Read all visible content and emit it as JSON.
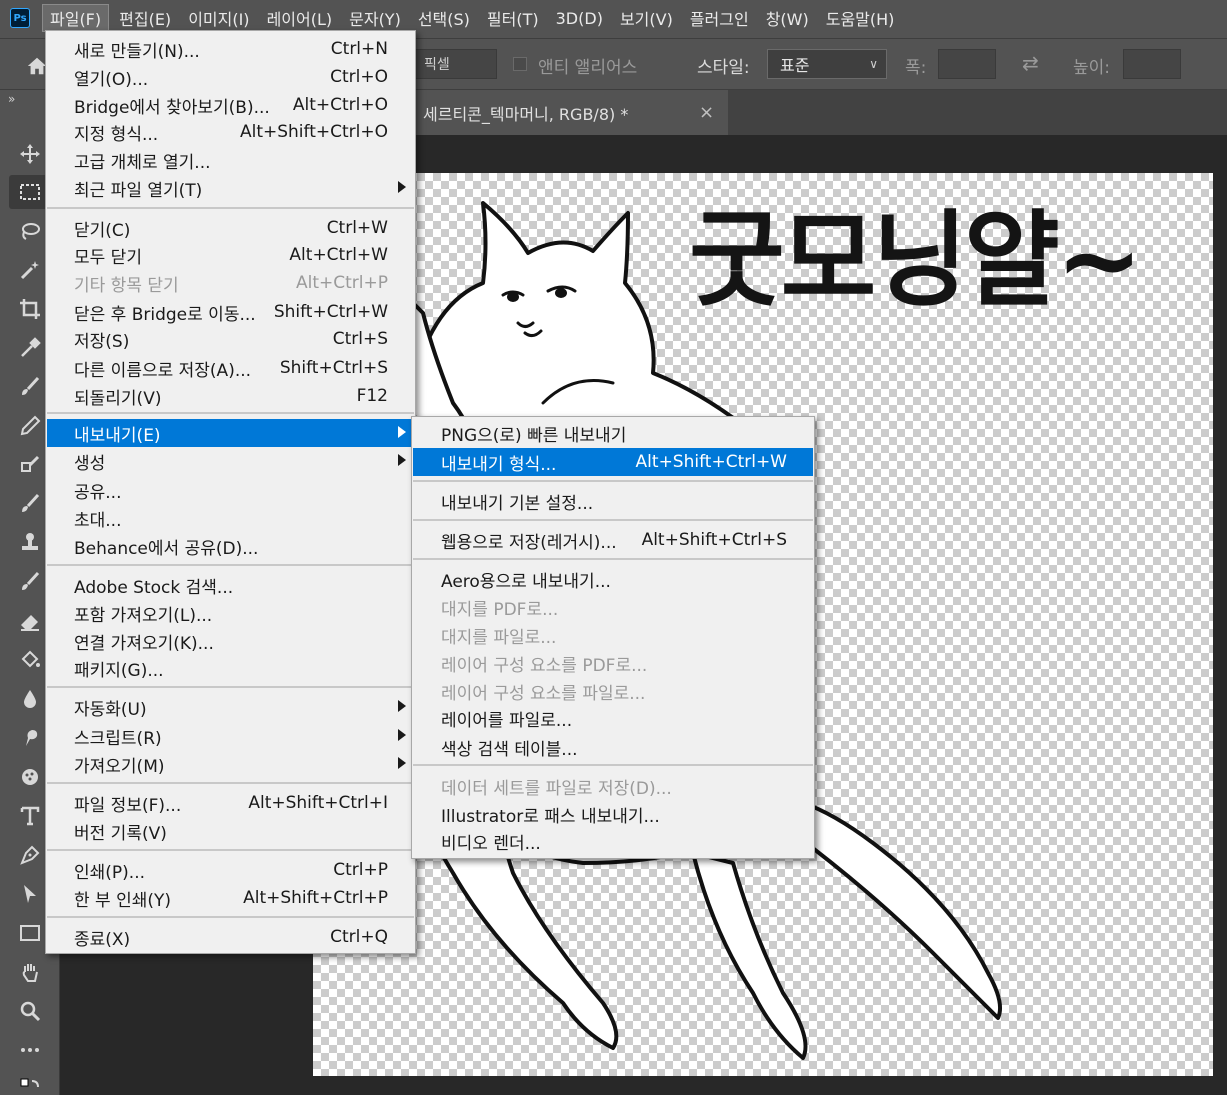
{
  "menubar": {
    "logo": "Ps",
    "items": [
      "파일(F)",
      "편집(E)",
      "이미지(I)",
      "레이어(L)",
      "문자(Y)",
      "선택(S)",
      "필터(T)",
      "3D(D)",
      "보기(V)",
      "플러그인",
      "창(W)",
      "도움말(H)"
    ]
  },
  "options": {
    "unit_field": "픽셀",
    "antialias_label": "앤티 앨리어스",
    "style_label": "스타일:",
    "style_value": "표준",
    "width_label": "폭:",
    "height_label": "높이:"
  },
  "document": {
    "tab_title": "세르티콘_텍마머니, RGB/8) *",
    "close": "×",
    "headline": "굿모닝얄~"
  },
  "file_menu": {
    "items": [
      {
        "label": "새로 만들기(N)...",
        "shortcut": "Ctrl+N"
      },
      {
        "label": "열기(O)...",
        "shortcut": "Ctrl+O"
      },
      {
        "label": "Bridge에서 찾아보기(B)...",
        "shortcut": "Alt+Ctrl+O"
      },
      {
        "label": "지정 형식...",
        "shortcut": "Alt+Shift+Ctrl+O"
      },
      {
        "label": "고급 개체로 열기...",
        "shortcut": ""
      },
      {
        "label": "최근 파일 열기(T)",
        "shortcut": ""
      },
      {
        "label": "닫기(C)",
        "shortcut": "Ctrl+W"
      },
      {
        "label": "모두 닫기",
        "shortcut": "Alt+Ctrl+W"
      },
      {
        "label": "기타 항목 닫기",
        "shortcut": "Alt+Ctrl+P"
      },
      {
        "label": "닫은 후 Bridge로 이동...",
        "shortcut": "Shift+Ctrl+W"
      },
      {
        "label": "저장(S)",
        "shortcut": "Ctrl+S"
      },
      {
        "label": "다른 이름으로 저장(A)...",
        "shortcut": "Shift+Ctrl+S"
      },
      {
        "label": "되돌리기(V)",
        "shortcut": "F12"
      },
      {
        "label": "내보내기(E)",
        "shortcut": ""
      },
      {
        "label": "생성",
        "shortcut": ""
      },
      {
        "label": "공유...",
        "shortcut": ""
      },
      {
        "label": "초대...",
        "shortcut": ""
      },
      {
        "label": "Behance에서 공유(D)...",
        "shortcut": ""
      },
      {
        "label": "Adobe Stock 검색...",
        "shortcut": ""
      },
      {
        "label": "포함 가져오기(L)...",
        "shortcut": ""
      },
      {
        "label": "연결 가져오기(K)...",
        "shortcut": ""
      },
      {
        "label": "패키지(G)...",
        "shortcut": ""
      },
      {
        "label": "자동화(U)",
        "shortcut": ""
      },
      {
        "label": "스크립트(R)",
        "shortcut": ""
      },
      {
        "label": "가져오기(M)",
        "shortcut": ""
      },
      {
        "label": "파일 정보(F)...",
        "shortcut": "Alt+Shift+Ctrl+I"
      },
      {
        "label": "버전 기록(V)",
        "shortcut": ""
      },
      {
        "label": "인쇄(P)...",
        "shortcut": "Ctrl+P"
      },
      {
        "label": "한 부 인쇄(Y)",
        "shortcut": "Alt+Shift+Ctrl+P"
      },
      {
        "label": "종료(X)",
        "shortcut": "Ctrl+Q"
      }
    ]
  },
  "export_menu": {
    "items": [
      {
        "label": "PNG으(로) 빠른 내보내기",
        "shortcut": ""
      },
      {
        "label": "내보내기 형식...",
        "shortcut": "Alt+Shift+Ctrl+W"
      },
      {
        "label": "내보내기 기본 설정...",
        "shortcut": ""
      },
      {
        "label": "웹용으로 저장(레거시)...",
        "shortcut": "Alt+Shift+Ctrl+S"
      },
      {
        "label": "Aero용으로 내보내기...",
        "shortcut": ""
      },
      {
        "label": "대지를 PDF로...",
        "shortcut": ""
      },
      {
        "label": "대지를 파일로...",
        "shortcut": ""
      },
      {
        "label": "레이어 구성 요소를 PDF로...",
        "shortcut": ""
      },
      {
        "label": "레이어 구성 요소를 파일로...",
        "shortcut": ""
      },
      {
        "label": "레이어를 파일로...",
        "shortcut": ""
      },
      {
        "label": "색상 검색 테이블...",
        "shortcut": ""
      },
      {
        "label": "데이터 세트를 파일로 저장(D)...",
        "shortcut": ""
      },
      {
        "label": "Illustrator로 패스 내보내기...",
        "shortcut": ""
      },
      {
        "label": "비디오 렌더...",
        "shortcut": ""
      }
    ]
  },
  "colors": {
    "highlight": "#0078d7",
    "menu_bg": "#f0f0f0",
    "chrome": "#535353"
  }
}
